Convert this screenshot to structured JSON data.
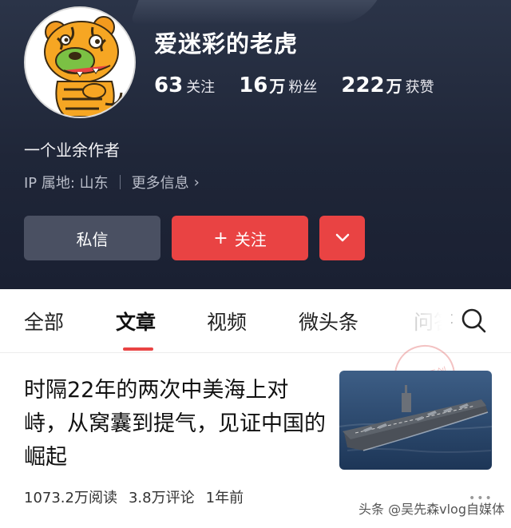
{
  "profile": {
    "nickname": "爱迷彩的老虎",
    "stats": [
      {
        "num": "63",
        "unit": "",
        "label": "关注"
      },
      {
        "num": "16",
        "unit": "万",
        "label": "粉丝"
      },
      {
        "num": "222",
        "unit": "万",
        "label": "获赞"
      }
    ],
    "bio": "一个业余作者",
    "ip_location": "IP 属地: 山东",
    "more_info": "更多信息",
    "header_bg_fragment": "202"
  },
  "actions": {
    "message_label": "私信",
    "follow_label": "关注",
    "follow_color": "#e94343"
  },
  "tabs": [
    {
      "label": "全部",
      "active": false
    },
    {
      "label": "文章",
      "active": true
    },
    {
      "label": "视频",
      "active": false
    },
    {
      "label": "微头条",
      "active": false
    },
    {
      "label": "问答",
      "active": false
    }
  ],
  "article": {
    "title": "时隔22年的两次中美海上对峙，从窝囊到提气，见证中国的崛起",
    "reads": "1073.2万阅读",
    "comments": "3.8万评论",
    "time": "1年前"
  },
  "stamp_text": "头条·原创",
  "watermark": "头条 @吴先森vlog自媒体",
  "icons": {
    "search": "search-icon",
    "chevron_right": "chevron-right-icon",
    "chevron_down": "chevron-down-icon",
    "plus": "plus-icon",
    "more": "more-dots-icon"
  }
}
